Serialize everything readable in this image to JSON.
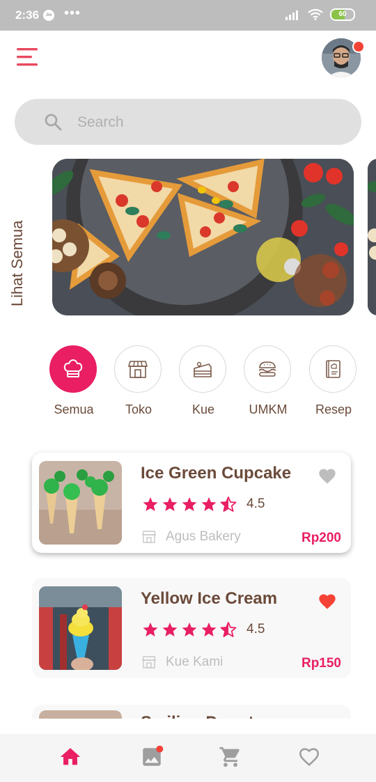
{
  "status_bar": {
    "time": "2:36",
    "carrier_icon": "Jio",
    "battery": "60",
    "dots": "•••"
  },
  "header": {
    "menu_icon": "menu-icon",
    "avatar": "user-avatar",
    "notification_dot": true
  },
  "search": {
    "placeholder": "Search",
    "value": ""
  },
  "banner": {
    "see_all_label": "Lihat Semua",
    "image": "pizza-banner"
  },
  "categories": [
    {
      "label": "Semua",
      "icon": "chef-hat-icon",
      "active": true
    },
    {
      "label": "Toko",
      "icon": "store-icon",
      "active": false
    },
    {
      "label": "Kue",
      "icon": "cake-icon",
      "active": false
    },
    {
      "label": "UMKM",
      "icon": "burger-icon",
      "active": false
    },
    {
      "label": "Resep",
      "icon": "recipe-book-icon",
      "active": false
    }
  ],
  "products": [
    {
      "title": "Ice Green Cupcake",
      "rating": "4.5",
      "store": "Agus Bakery",
      "price": "Rp200",
      "favorite": false
    },
    {
      "title": "Yellow Ice Cream",
      "rating": "4.5",
      "store": "Kue Kami",
      "price": "Rp150",
      "favorite": true
    },
    {
      "title": "Smiling Donuts",
      "partial": true
    }
  ],
  "bottom_nav": [
    {
      "name": "home-icon",
      "active": true
    },
    {
      "name": "gallery-icon",
      "badge": true
    },
    {
      "name": "cart-icon"
    },
    {
      "name": "favorite-icon"
    }
  ],
  "colors": {
    "accent": "#e91e63",
    "text": "#6b4a3a",
    "muted": "#bdbdbd",
    "heart_active": "#f44336"
  }
}
